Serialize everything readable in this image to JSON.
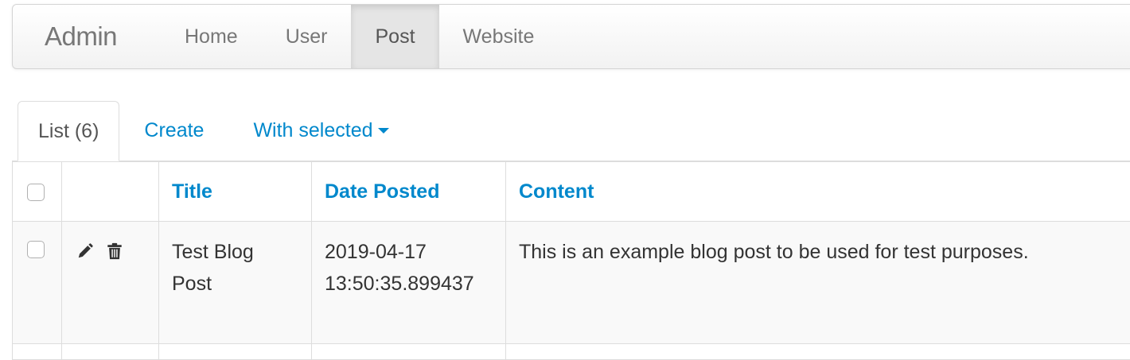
{
  "navbar": {
    "brand": "Admin",
    "items": [
      {
        "label": "Home",
        "active": false
      },
      {
        "label": "User",
        "active": false
      },
      {
        "label": "Post",
        "active": true
      },
      {
        "label": "Website",
        "active": false
      }
    ]
  },
  "tabs": {
    "list_label": "List (6)",
    "create_label": "Create",
    "with_selected_label": "With selected"
  },
  "table": {
    "columns": [
      "Title",
      "Date Posted",
      "Content"
    ],
    "rows": [
      {
        "title": "Test Blog Post",
        "date_posted": "2019-04-17 13:50:35.899437",
        "content": "This is an example blog post to be used for test purposes."
      }
    ]
  },
  "icons": {
    "edit": "pencil-icon",
    "delete": "trash-icon"
  },
  "colors": {
    "link": "#0088cc",
    "nav_text": "#777777",
    "border": "#dddddd",
    "row_bg": "#f9f9f9"
  }
}
